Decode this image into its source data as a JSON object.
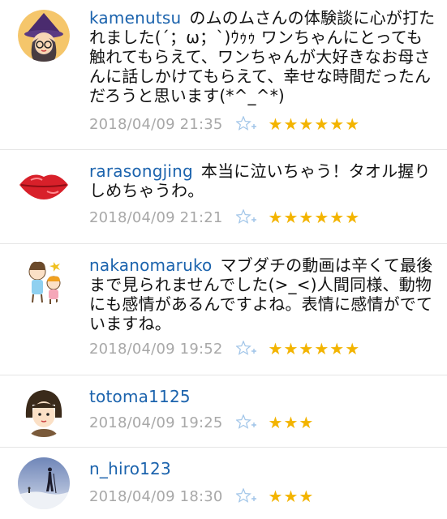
{
  "comments": [
    {
      "username": "kamenutsu",
      "text": "のムのムさんの体験談に心が打たれました(´；ω；`)ｳｩｩ ワンちゃんにとっても触れてもらえて、ワンちゃんが大好きなお母さんに話しかけてもらえて、幸せな時間だったんだろうと思います(*^_^*)",
      "timestamp": "2018/04/09 21:35",
      "stars": "★★★★★★",
      "avatar_icon": "witch-avatar-icon"
    },
    {
      "username": "rarasongjing",
      "text": "本当に泣いちゃう！タオル握りしめちゃうわ。",
      "timestamp": "2018/04/09 21:21",
      "stars": "★★★★★★",
      "avatar_icon": "red-lips-icon"
    },
    {
      "username": "nakanomaruko",
      "text": "マブダチの動画は辛くて最後まで見られませんでした(>_<)人間同様、動物にも感情があるんですよね。表情に感情がでていますね。",
      "timestamp": "2018/04/09 19:52",
      "stars": "★★★★★★",
      "avatar_icon": "kids-illustration-icon"
    },
    {
      "username": "totoma1125",
      "text": "",
      "timestamp": "2018/04/09 19:25",
      "stars": "★★★",
      "avatar_icon": "girl-bob-hair-icon"
    },
    {
      "username": "n_hiro123",
      "text": "",
      "timestamp": "2018/04/09 18:30",
      "stars": "★★★",
      "avatar_icon": "climber-photo-icon"
    }
  ],
  "colors": {
    "username": "#1b63ad",
    "timestamp": "#a8a8a8",
    "star": "#f3b400",
    "favorite_icon": "#9fc4e8"
  }
}
